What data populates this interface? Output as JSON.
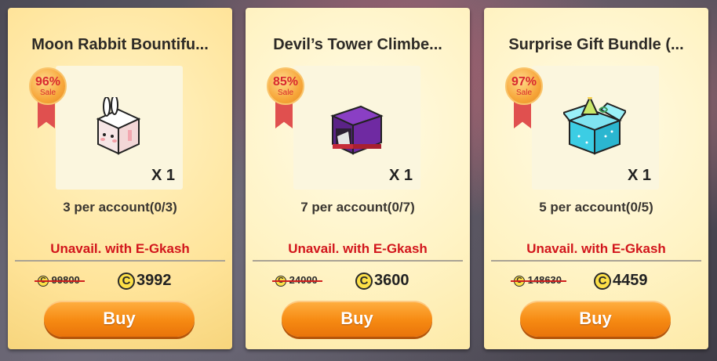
{
  "cards": [
    {
      "title": "Moon Rabbit Bountifu...",
      "discount": "96%",
      "sale_label": "Sale",
      "quantity": "X 1",
      "limit": "3 per account(0/3)",
      "notice": "Unavail. with E-Gkash",
      "original_price": "99800",
      "price": "3992",
      "buy_label": "Buy",
      "icon": "rabbit-box-icon"
    },
    {
      "title": "Devil’s Tower Climbe...",
      "discount": "85%",
      "sale_label": "Sale",
      "quantity": "X 1",
      "limit": "7 per account(0/7)",
      "notice": "Unavail. with E-Gkash",
      "original_price": "24000",
      "price": "3600",
      "buy_label": "Buy",
      "icon": "devil-tower-box-icon"
    },
    {
      "title": "Surprise Gift Bundle (...",
      "discount": "97%",
      "sale_label": "Sale",
      "quantity": "X 1",
      "limit": "5 per account(0/5)",
      "notice": "Unavail. with E-Gkash",
      "original_price": "148630",
      "price": "4459",
      "buy_label": "Buy",
      "icon": "gift-box-icon"
    }
  ],
  "currency_symbol": "C",
  "colors": {
    "accent_orange": "#f68a12",
    "notice_red": "#d2161c",
    "card_bg": "#fff3c4"
  }
}
